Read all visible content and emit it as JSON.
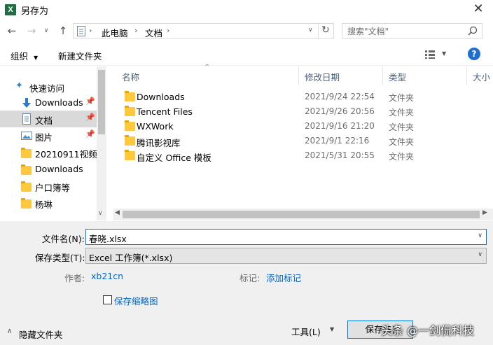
{
  "window": {
    "title": "另存为",
    "app_icon": "excel-icon",
    "app_icon_letter": "X"
  },
  "address": {
    "crumbs": [
      "此电脑",
      "文档"
    ],
    "search_placeholder": "搜索\"文档\""
  },
  "toolbar": {
    "organize": "组织",
    "new_folder": "新建文件夹"
  },
  "nav": {
    "items": [
      {
        "label": "快速访问",
        "icon": "star-icon",
        "pinned": false,
        "selected": false
      },
      {
        "label": "Downloads",
        "icon": "download-arrow-icon",
        "pinned": true,
        "selected": false
      },
      {
        "label": "文档",
        "icon": "document-icon",
        "pinned": true,
        "selected": true
      },
      {
        "label": "图片",
        "icon": "picture-icon",
        "pinned": true,
        "selected": false
      },
      {
        "label": "20210911视频",
        "icon": "folder-icon",
        "pinned": false,
        "selected": false
      },
      {
        "label": "Downloads",
        "icon": "folder-icon",
        "pinned": false,
        "selected": false
      },
      {
        "label": "户口簿等",
        "icon": "folder-icon",
        "pinned": false,
        "selected": false
      },
      {
        "label": "杨琳",
        "icon": "folder-icon",
        "pinned": false,
        "selected": false
      }
    ]
  },
  "columns": {
    "name": "名称",
    "modified": "修改日期",
    "type": "类型",
    "size": "大小"
  },
  "files": [
    {
      "name": "Downloads",
      "modified": "2021/9/24 22:54",
      "type": "文件夹"
    },
    {
      "name": "Tencent Files",
      "modified": "2021/9/26 20:56",
      "type": "文件夹"
    },
    {
      "name": "WXWork",
      "modified": "2021/9/16 21:20",
      "type": "文件夹"
    },
    {
      "name": "腾讯影视库",
      "modified": "2021/9/1 22:16",
      "type": "文件夹"
    },
    {
      "name": "自定义 Office 模板",
      "modified": "2021/5/31 20:55",
      "type": "文件夹"
    }
  ],
  "form": {
    "filename_label": "文件名(N):",
    "filename_value": "春晓.xlsx",
    "filetype_label": "保存类型(T):",
    "filetype_value": "Excel 工作簿(*.xlsx)",
    "author_label": "作者:",
    "author_value": "xb21cn",
    "tags_label": "标记:",
    "tags_value": "添加标记",
    "thumbnail_label": "保存缩略图",
    "thumbnail_checked": false
  },
  "footer": {
    "hide_folders": "隐藏文件夹",
    "tools": "工具(L)",
    "save": "保存(S)",
    "watermark": "头条 @一剑侃科技"
  },
  "colors": {
    "accent": "#0078d7",
    "link": "#0066cc",
    "folder": "#ffc83d",
    "excel": "#1d6f42",
    "help": "#1e6fd0"
  }
}
